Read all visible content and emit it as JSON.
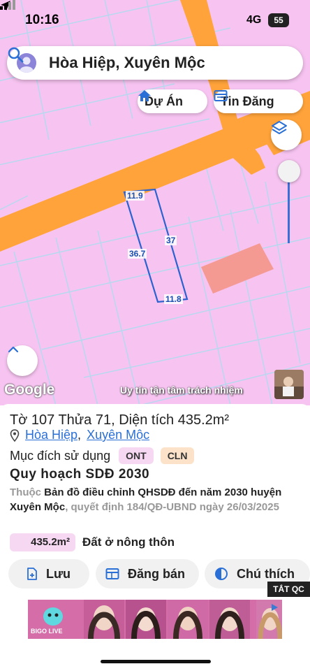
{
  "status_bar": {
    "time": "10:16",
    "network": "4G",
    "battery": "55"
  },
  "search": {
    "query": "Hòa Hiệp, Xuyên Mộc"
  },
  "map_buttons": {
    "project_label": "Dự Án",
    "listing_label": "Tin Đăng"
  },
  "map_overlay": {
    "dimensions": [
      "11.9",
      "37",
      "36.7",
      "11.8"
    ],
    "google_logo": "Google",
    "slogan": "Uy tín tận tâm trách nhiệm"
  },
  "parcel": {
    "heading": "Tờ 107 Thửa 71, Diện tích 435.2m²",
    "commune": "Hòa Hiệp",
    "district": "Xuyên Mộc",
    "separator": ",",
    "purpose_label": "Mục đích sử dụng",
    "land_codes": [
      "ONT",
      "CLN"
    ],
    "plan_title": "Quy hoạch SDĐ 2030",
    "plan_prefix": "Thuộc",
    "plan_name": "Bản đồ điều chỉnh QHSDĐ đến năm 2030 huyện Xuyên Mộc",
    "plan_suffix": ", quyết định 184/QĐ-UBND ngày 26/03/2025",
    "area_value": "435.2m²",
    "area_type": "Đất ở nông thôn"
  },
  "actions": {
    "save": "Lưu",
    "sell": "Đăng bán",
    "legend": "Chú thích"
  },
  "ad": {
    "close_label": "TẮT QC",
    "brand": "BIGO LIVE"
  },
  "colors": {
    "map_zone": "#f7c4f1",
    "road": "#ffa33a",
    "parcel_outline": "#2b62d0",
    "accent": "#2a6fd6"
  }
}
